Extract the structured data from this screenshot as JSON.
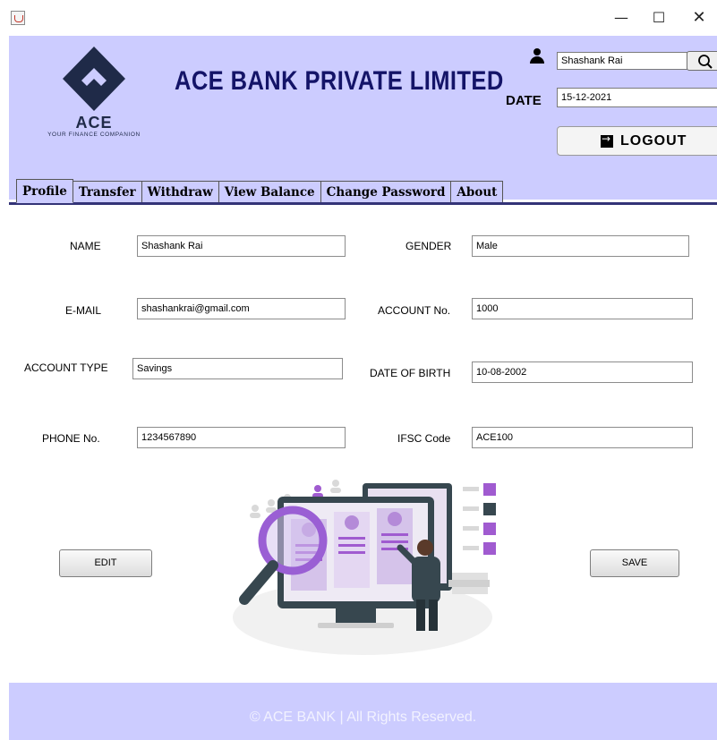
{
  "window": {
    "min_glyph": "—",
    "max_glyph": "☐",
    "close_glyph": "✕"
  },
  "header": {
    "logo_text": "ACE",
    "logo_tagline": "YOUR FINANCE COMPANION",
    "bank_name": "ACE BANK PRIVATE LIMITED",
    "user_name": "Shashank Rai",
    "date_label": "DATE",
    "date_value": "15-12-2021",
    "logout_label": "LOGOUT"
  },
  "tabs": [
    {
      "label": "Profile",
      "active": true
    },
    {
      "label": "Transfer",
      "active": false
    },
    {
      "label": "Withdraw",
      "active": false
    },
    {
      "label": "View Balance",
      "active": false
    },
    {
      "label": "Change Password",
      "active": false
    },
    {
      "label": "About",
      "active": false
    }
  ],
  "profile": {
    "name_label": "NAME",
    "name_value": "Shashank Rai",
    "gender_label": "GENDER",
    "gender_value": "Male",
    "email_label": "E-MAIL",
    "email_value": "shashankrai@gmail.com",
    "account_no_label": "ACCOUNT No.",
    "account_no_value": "1000",
    "account_type_label": "ACCOUNT TYPE",
    "account_type_value": "Savings",
    "dob_label": "DATE OF BIRTH",
    "dob_value": "10-08-2002",
    "phone_label": "PHONE No.",
    "phone_value": "1234567890",
    "ifsc_label": "IFSC Code",
    "ifsc_value": "ACE100"
  },
  "buttons": {
    "edit_label": "EDIT",
    "save_label": "SAVE"
  },
  "footer": {
    "text": "© ACE BANK | All Rights Reserved."
  },
  "colors": {
    "header_bg": "#ccccff",
    "title_color": "#141468",
    "logo_color": "#1f2a48"
  }
}
